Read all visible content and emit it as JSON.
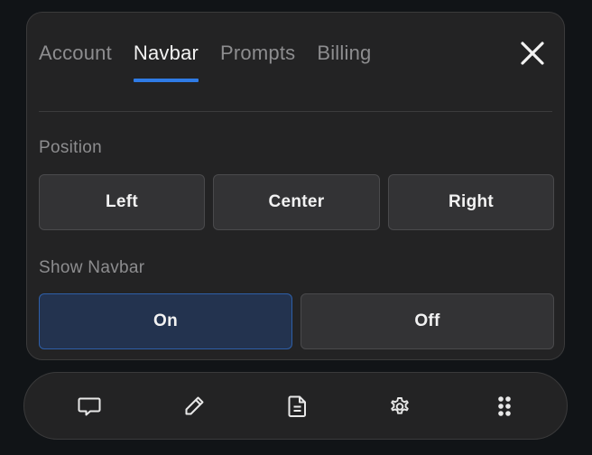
{
  "settings": {
    "tabs": [
      {
        "label": "Account",
        "active": false
      },
      {
        "label": "Navbar",
        "active": true
      },
      {
        "label": "Prompts",
        "active": false
      },
      {
        "label": "Billing",
        "active": false
      }
    ],
    "close_icon": "close-icon",
    "position": {
      "label": "Position",
      "options": [
        "Left",
        "Center",
        "Right"
      ],
      "selected": null
    },
    "show_navbar": {
      "label": "Show Navbar",
      "options": [
        "On",
        "Off"
      ],
      "selected": "On"
    }
  },
  "navbar": {
    "icons": [
      "chat-bubble-icon",
      "pencil-icon",
      "document-icon",
      "gear-icon",
      "dots-grid-icon"
    ]
  },
  "colors": {
    "background": "#111417",
    "panel": "#232324",
    "accent": "#2f7be6",
    "selected_fill": "#23334f"
  }
}
